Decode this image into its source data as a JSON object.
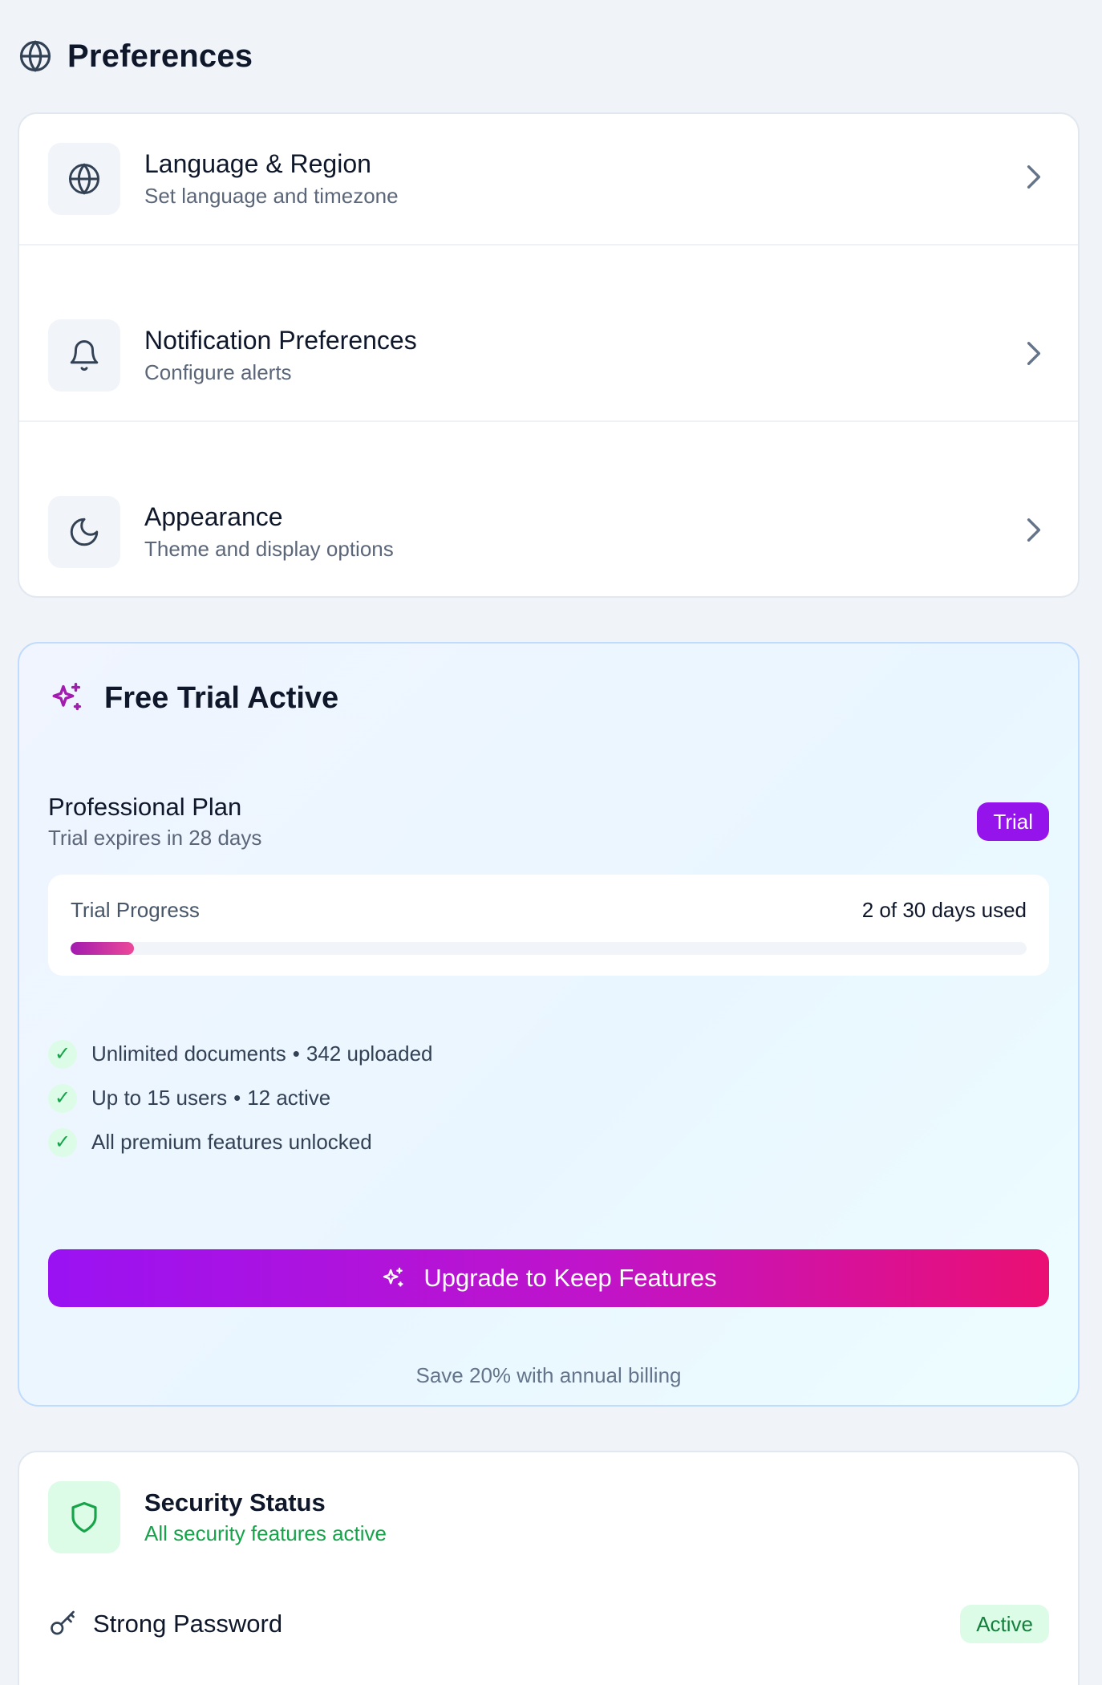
{
  "section": {
    "title": "Preferences",
    "icon": "globe-icon"
  },
  "preferences": [
    {
      "title": "Language & Region",
      "subtitle": "Set language and timezone",
      "icon": "globe-icon"
    },
    {
      "title": "Notification Preferences",
      "subtitle": "Configure alerts",
      "icon": "bell-icon"
    },
    {
      "title": "Appearance",
      "subtitle": "Theme and display options",
      "icon": "moon-icon"
    }
  ],
  "trial": {
    "title": "Free Trial Active",
    "plan_name": "Professional Plan",
    "expires": "Trial expires in 28 days",
    "badge": "Trial",
    "progress_label": "Trial Progress",
    "progress_value": "2 of 30 days used",
    "days_used": 2,
    "days_total": 30,
    "features": [
      {
        "text": "Unlimited documents",
        "detail": "342 uploaded"
      },
      {
        "text": "Up to 15 users",
        "detail": "12 active"
      },
      {
        "text": "All premium features unlocked",
        "detail": ""
      }
    ],
    "upgrade_label": "Upgrade to Keep Features",
    "save_note": "Save 20% with annual billing",
    "colors": {
      "accent": "#9614ec",
      "gradient_end": "#ea0f72"
    }
  },
  "security": {
    "title": "Security Status",
    "subtitle": "All security features active",
    "items": [
      {
        "label": "Strong Password",
        "status": "Active"
      }
    ],
    "colors": {
      "ok": "#16a34a"
    }
  }
}
